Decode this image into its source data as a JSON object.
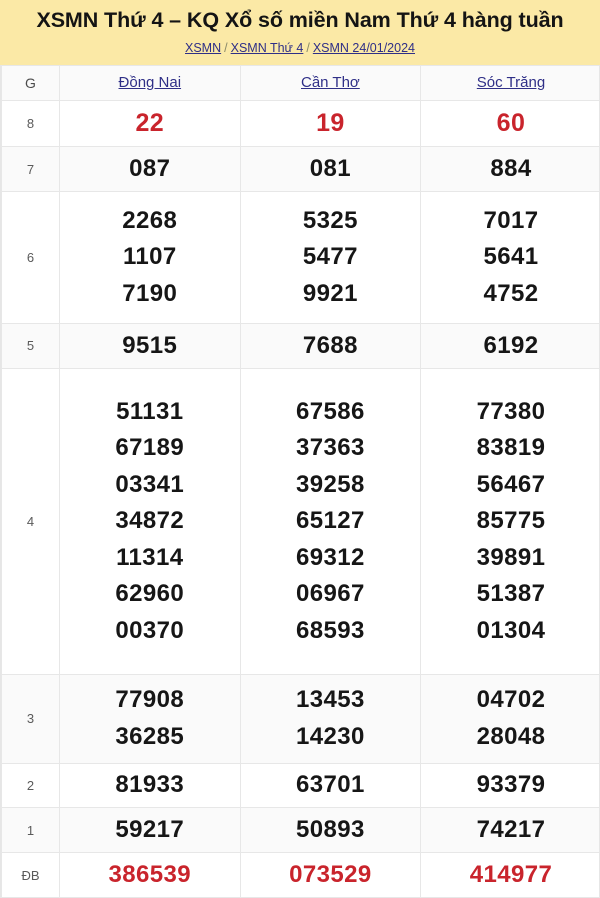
{
  "header": {
    "title": "XSMN Thứ 4 – KQ Xổ số miền Nam Thứ 4 hàng tuần",
    "breadcrumb": [
      {
        "label": "XSMN"
      },
      {
        "label": "XSMN Thứ 4"
      },
      {
        "label": "XSMN 24/01/2024"
      }
    ],
    "breadcrumb_separator": "/",
    "background_color": "#fbe9a6"
  },
  "table": {
    "prize_column_header": "G",
    "provinces": [
      "Đồng Nai",
      "Cần Thơ",
      "Sóc Trăng"
    ],
    "highlight_color": "#c9242c",
    "rows": [
      {
        "prize": "8",
        "stripe": false,
        "highlight": true,
        "cells": [
          [
            "22"
          ],
          [
            "19"
          ],
          [
            "60"
          ]
        ]
      },
      {
        "prize": "7",
        "stripe": true,
        "highlight": false,
        "cells": [
          [
            "087"
          ],
          [
            "081"
          ],
          [
            "884"
          ]
        ]
      },
      {
        "prize": "6",
        "stripe": false,
        "highlight": false,
        "cells": [
          [
            "2268",
            "1107",
            "7190"
          ],
          [
            "5325",
            "5477",
            "9921"
          ],
          [
            "7017",
            "5641",
            "4752"
          ]
        ]
      },
      {
        "prize": "5",
        "stripe": true,
        "highlight": false,
        "cells": [
          [
            "9515"
          ],
          [
            "7688"
          ],
          [
            "6192"
          ]
        ]
      },
      {
        "prize": "4",
        "stripe": false,
        "highlight": false,
        "cells": [
          [
            "51131",
            "67189",
            "03341",
            "34872",
            "11314",
            "62960",
            "00370"
          ],
          [
            "67586",
            "37363",
            "39258",
            "65127",
            "69312",
            "06967",
            "68593"
          ],
          [
            "77380",
            "83819",
            "56467",
            "85775",
            "39891",
            "51387",
            "01304"
          ]
        ]
      },
      {
        "prize": "3",
        "stripe": true,
        "highlight": false,
        "cells": [
          [
            "77908",
            "36285"
          ],
          [
            "13453",
            "14230"
          ],
          [
            "04702",
            "28048"
          ]
        ]
      },
      {
        "prize": "2",
        "stripe": false,
        "highlight": false,
        "cells": [
          [
            "81933"
          ],
          [
            "63701"
          ],
          [
            "93379"
          ]
        ]
      },
      {
        "prize": "1",
        "stripe": true,
        "highlight": false,
        "cells": [
          [
            "59217"
          ],
          [
            "50893"
          ],
          [
            "74217"
          ]
        ]
      },
      {
        "prize": "ĐB",
        "stripe": false,
        "highlight": true,
        "cells": [
          [
            "386539"
          ],
          [
            "073529"
          ],
          [
            "414977"
          ]
        ]
      }
    ]
  }
}
